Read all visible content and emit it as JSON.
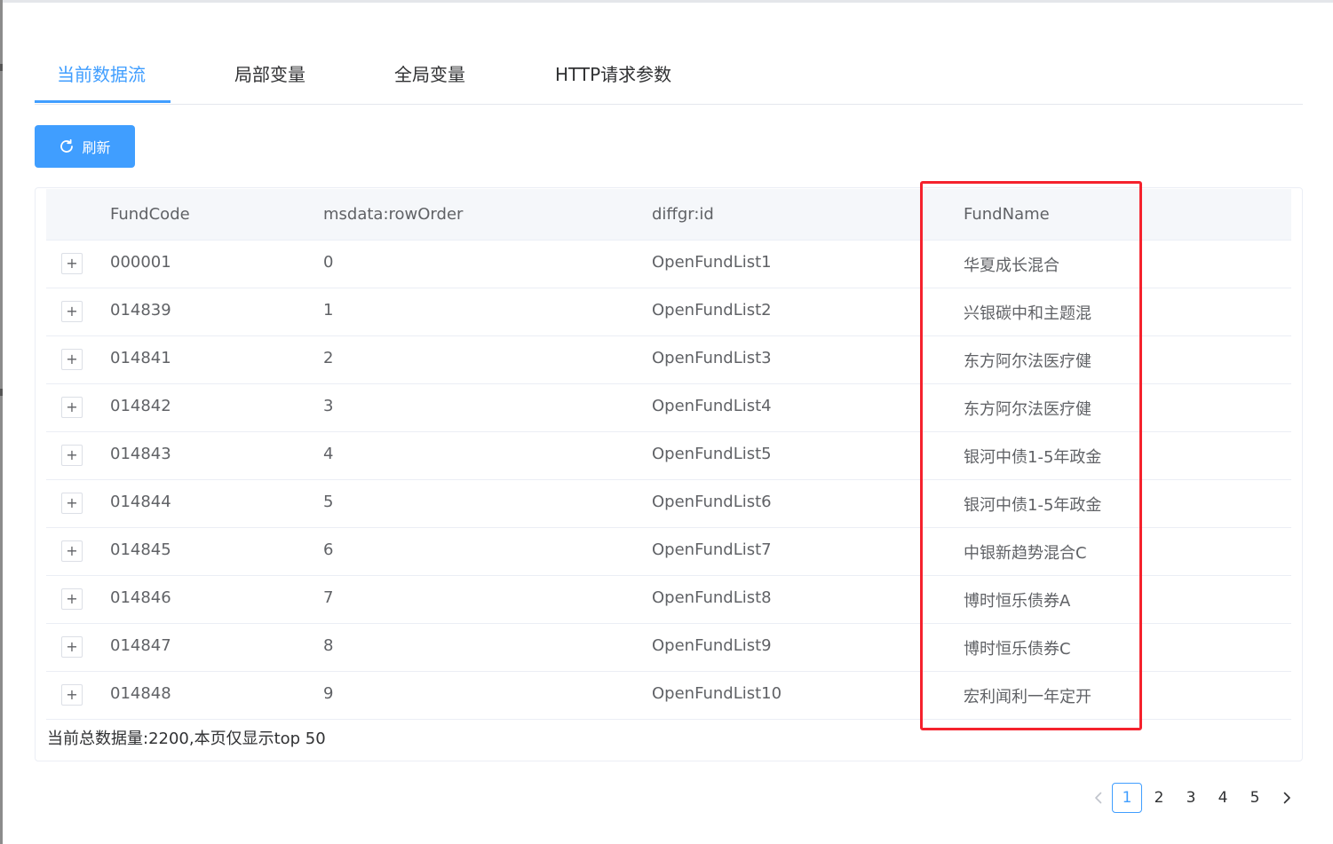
{
  "tabs": [
    {
      "label": "当前数据流",
      "active": true
    },
    {
      "label": "局部变量",
      "active": false
    },
    {
      "label": "全局变量",
      "active": false
    },
    {
      "label": "HTTP请求参数",
      "active": false
    }
  ],
  "toolbar": {
    "refresh_label": "刷新",
    "refresh_icon": "refresh-icon"
  },
  "table": {
    "columns": [
      "FundCode",
      "msdata:rowOrder",
      "diffgr:id",
      "FundName"
    ],
    "rows": [
      {
        "expand": "+",
        "FundCode": "000001",
        "rowOrder": "0",
        "id": "OpenFundList1",
        "FundName": "华夏成长混合"
      },
      {
        "expand": "+",
        "FundCode": "014839",
        "rowOrder": "1",
        "id": "OpenFundList2",
        "FundName": "兴银碳中和主题混"
      },
      {
        "expand": "+",
        "FundCode": "014841",
        "rowOrder": "2",
        "id": "OpenFundList3",
        "FundName": "东方阿尔法医疗健"
      },
      {
        "expand": "+",
        "FundCode": "014842",
        "rowOrder": "3",
        "id": "OpenFundList4",
        "FundName": "东方阿尔法医疗健"
      },
      {
        "expand": "+",
        "FundCode": "014843",
        "rowOrder": "4",
        "id": "OpenFundList5",
        "FundName": "银河中债1-5年政金"
      },
      {
        "expand": "+",
        "FundCode": "014844",
        "rowOrder": "5",
        "id": "OpenFundList6",
        "FundName": "银河中债1-5年政金"
      },
      {
        "expand": "+",
        "FundCode": "014845",
        "rowOrder": "6",
        "id": "OpenFundList7",
        "FundName": "中银新趋势混合C"
      },
      {
        "expand": "+",
        "FundCode": "014846",
        "rowOrder": "7",
        "id": "OpenFundList8",
        "FundName": "博时恒乐债券A"
      },
      {
        "expand": "+",
        "FundCode": "014847",
        "rowOrder": "8",
        "id": "OpenFundList9",
        "FundName": "博时恒乐债券C"
      },
      {
        "expand": "+",
        "FundCode": "014848",
        "rowOrder": "9",
        "id": "OpenFundList10",
        "FundName": "宏利闻利一年定开"
      }
    ],
    "footer": "当前总数据量:2200,本页仅显示top 50"
  },
  "pagination": {
    "pages": [
      "1",
      "2",
      "3",
      "4",
      "5"
    ],
    "current": "1",
    "prev_icon": "chevron-left-icon",
    "next_icon": "chevron-right-icon"
  },
  "colors": {
    "accent": "#409eff",
    "highlight": "#f5222d"
  }
}
